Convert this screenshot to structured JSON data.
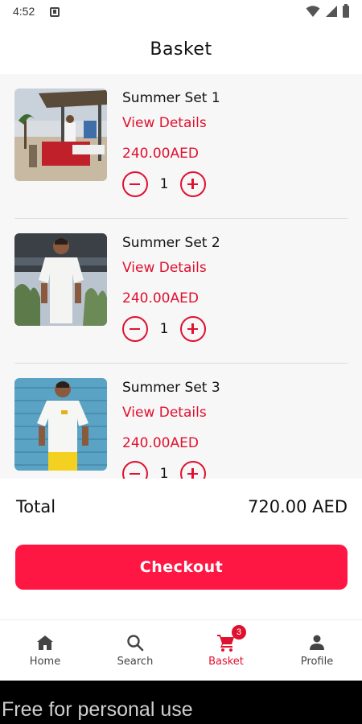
{
  "status_bar": {
    "time": "4:52"
  },
  "app_bar": {
    "title": "Basket"
  },
  "cart": {
    "items": [
      {
        "name": "Summer Set 1",
        "details_link": "View Details",
        "price": "240.00AED",
        "quantity": "1"
      },
      {
        "name": "Summer Set 2",
        "details_link": "View Details",
        "price": "240.00AED",
        "quantity": "1"
      },
      {
        "name": "Summer Set 3",
        "details_link": "View Details",
        "price": "240.00AED",
        "quantity": "1"
      }
    ]
  },
  "summary": {
    "total_label": "Total",
    "total_value": "720.00 AED"
  },
  "checkout": {
    "label": "Checkout"
  },
  "bottom_nav": {
    "items": [
      {
        "label": "Home",
        "icon": "home-icon"
      },
      {
        "label": "Search",
        "icon": "search-icon"
      },
      {
        "label": "Basket",
        "icon": "cart-icon",
        "badge": "3",
        "active": true
      },
      {
        "label": "Profile",
        "icon": "person-icon"
      }
    ]
  },
  "watermark": {
    "text": "Free for personal use"
  },
  "colors": {
    "accent": "#ff1744",
    "text_accent": "#e0112f",
    "background": "#f7f7f7"
  }
}
